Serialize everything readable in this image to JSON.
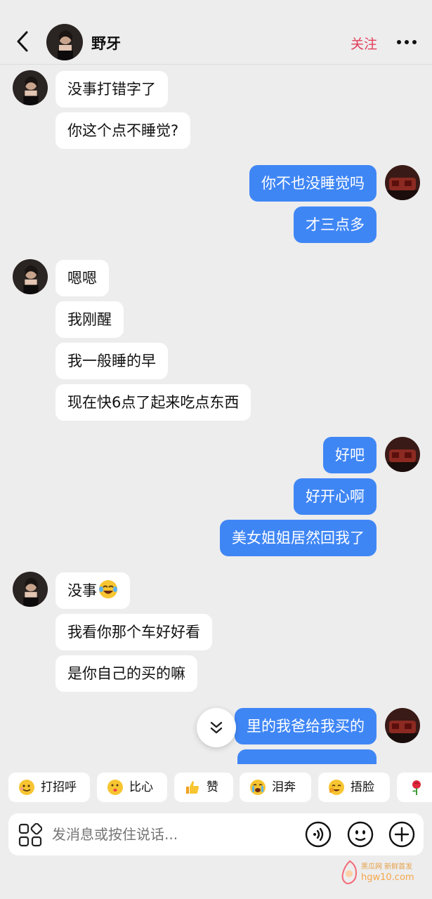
{
  "header": {
    "contact_name": "野牙",
    "follow_label": "关注",
    "back_icon": "chevron-left-icon",
    "more_icon": "more-dots-icon"
  },
  "messages": [
    {
      "side": "received",
      "text": "没事打错字了"
    },
    {
      "side": "received",
      "text": "你这个点不睡觉?"
    },
    {
      "side": "sent",
      "text": "你不也没睡觉吗"
    },
    {
      "side": "sent",
      "text": "才三点多"
    },
    {
      "side": "received",
      "text": "嗯嗯"
    },
    {
      "side": "received",
      "text": "我刚醒"
    },
    {
      "side": "received",
      "text": "我一般睡的早"
    },
    {
      "side": "received",
      "text": "现在快6点了起来吃点东西"
    },
    {
      "side": "sent",
      "text": "好吧"
    },
    {
      "side": "sent",
      "text": "好开心啊"
    },
    {
      "side": "sent",
      "text": "美女姐姐居然回我了"
    },
    {
      "side": "received",
      "text": "没事"
    },
    {
      "side": "received",
      "text": "我看你那个车好好看"
    },
    {
      "side": "received",
      "text": "是你自己的买的嘛"
    },
    {
      "side": "sent",
      "text": "里的我爸给我买的"
    }
  ],
  "quick_replies": [
    {
      "label": "打招呼",
      "icon": "wave-emoji-icon"
    },
    {
      "label": "比心",
      "icon": "heart-hands-emoji-icon"
    },
    {
      "label": "赞",
      "icon": "thumbs-up-icon"
    },
    {
      "label": "泪奔",
      "icon": "crying-emoji-icon"
    },
    {
      "label": "捂脸",
      "icon": "facepalm-emoji-icon"
    },
    {
      "label": "",
      "icon": "rose-icon"
    }
  ],
  "input": {
    "placeholder": "发消息或按住说话..."
  },
  "watermark": {
    "line1": "黑瓜网 新鲜首发",
    "line2": "hgw10.com"
  },
  "colors": {
    "sent_bubble": "#3f86f5",
    "received_bubble": "#ffffff",
    "follow": "#e33e5a",
    "background": "#ededed"
  }
}
